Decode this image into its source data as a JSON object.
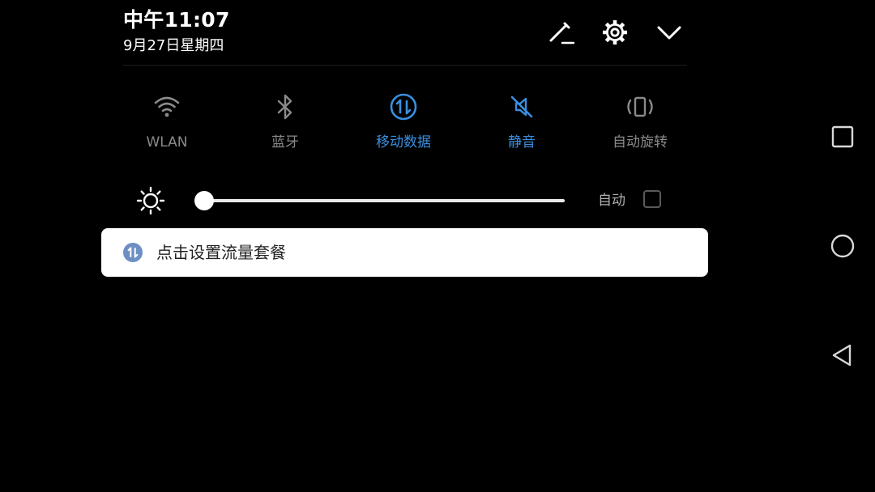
{
  "status": {
    "time": "中午11:07",
    "date": "9月27日星期四"
  },
  "header_icons": [
    {
      "name": "edit-icon"
    },
    {
      "name": "settings-gear-icon"
    },
    {
      "name": "collapse-chevron-down-icon"
    }
  ],
  "quick_settings": [
    {
      "id": "wlan",
      "label": "WLAN",
      "icon": "wifi-icon",
      "active": false
    },
    {
      "id": "bluetooth",
      "label": "蓝牙",
      "icon": "bluetooth-icon",
      "active": false
    },
    {
      "id": "mobile-data",
      "label": "移动数据",
      "icon": "mobile-data-icon",
      "active": true
    },
    {
      "id": "mute",
      "label": "静音",
      "icon": "mute-icon",
      "active": true
    },
    {
      "id": "auto-rotate",
      "label": "自动旋转",
      "icon": "auto-rotate-icon",
      "active": false
    }
  ],
  "brightness": {
    "icon": "brightness-sun-icon",
    "level_fraction": 0.0,
    "auto_label": "自动",
    "auto_checked": false
  },
  "notification": {
    "icon": "mobile-data-icon",
    "text": "点击设置流量套餐"
  },
  "nav_bar": [
    {
      "name": "recent-apps-square-icon"
    },
    {
      "name": "home-circle-icon"
    },
    {
      "name": "back-triangle-icon"
    }
  ],
  "colors": {
    "background": "#000000",
    "accent": "#3a8fe0",
    "inactive": "#8a8a8a",
    "notification_bg": "#ffffff",
    "notification_icon": "#6d8fc4"
  }
}
